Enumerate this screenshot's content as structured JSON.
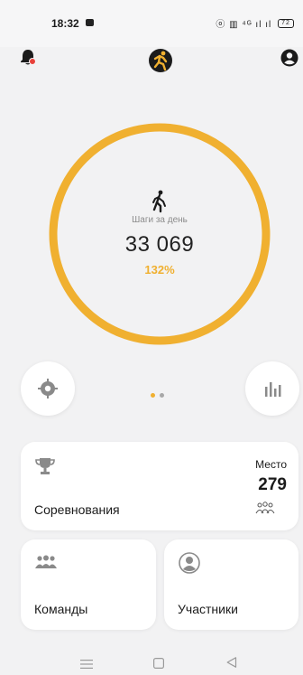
{
  "status": {
    "time": "18:32",
    "right_icons_text": "ⓞ ▥ ⁴ᴳ ıl ıl",
    "battery": "72"
  },
  "header": {
    "icons": [
      "bell-icon",
      "runner-logo-icon",
      "profile-icon"
    ],
    "accent_color": "#f0b030"
  },
  "steps": {
    "label": "Шаги за день",
    "value": "33 069",
    "percent": "132%",
    "progress_fraction": 1.0
  },
  "pager": {
    "pages": 2,
    "active": 0
  },
  "cards": {
    "competitions": {
      "title": "Соревнования",
      "place_label": "Место",
      "place_value": "279"
    },
    "teams": {
      "title": "Команды"
    },
    "participants": {
      "title": "Участники"
    }
  },
  "colors": {
    "background": "#f2f2f3",
    "card": "#ffffff",
    "accent": "#f0b030",
    "icon_gray": "#8a8a8a"
  }
}
